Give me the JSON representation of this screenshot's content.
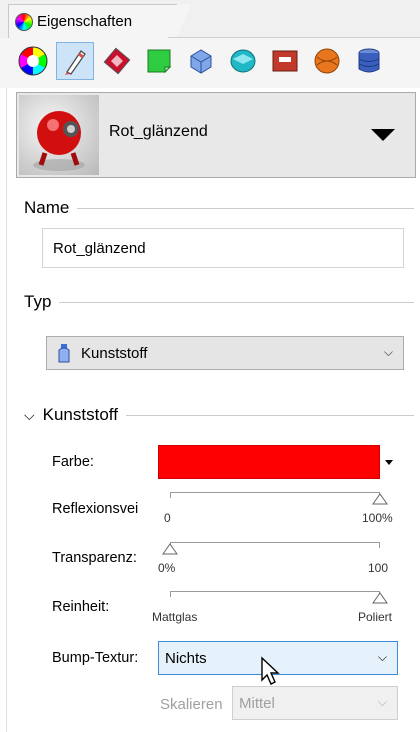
{
  "tab": {
    "label": "Eigenschaften",
    "icon": "color-wheel-icon"
  },
  "toolbar": {
    "buttons": [
      {
        "name": "color-wheel",
        "active": false
      },
      {
        "name": "brush",
        "active": true
      },
      {
        "name": "material-patch",
        "active": false
      },
      {
        "name": "green-texture",
        "active": false
      },
      {
        "name": "blue-cube",
        "active": false
      },
      {
        "name": "teal-box",
        "active": false
      },
      {
        "name": "red-panel",
        "active": false
      },
      {
        "name": "orange-sphere",
        "active": false
      },
      {
        "name": "database",
        "active": false
      }
    ]
  },
  "material": {
    "name": "Rot_glänzend"
  },
  "name_section": {
    "title": "Name",
    "value": "Rot_glänzend"
  },
  "type_section": {
    "title": "Typ",
    "value": "Kunststoff"
  },
  "plastic_section": {
    "title": "Kunststoff",
    "color_label": "Farbe:",
    "color_value": "#ff0000",
    "reflection": {
      "label": "Reflexionsvei",
      "min": "0",
      "max": "100%",
      "value": 1.0
    },
    "transparency": {
      "label": "Transparenz:",
      "min": "0%",
      "max": "100",
      "value": 0.0
    },
    "purity": {
      "label": "Reinheit:",
      "min": "Mattglas",
      "max": "Poliert",
      "value": 1.0
    },
    "bump": {
      "label": "Bump-Textur:",
      "value": "Nichts"
    },
    "scale": {
      "label": "Skalieren",
      "value": "Mittel"
    }
  }
}
